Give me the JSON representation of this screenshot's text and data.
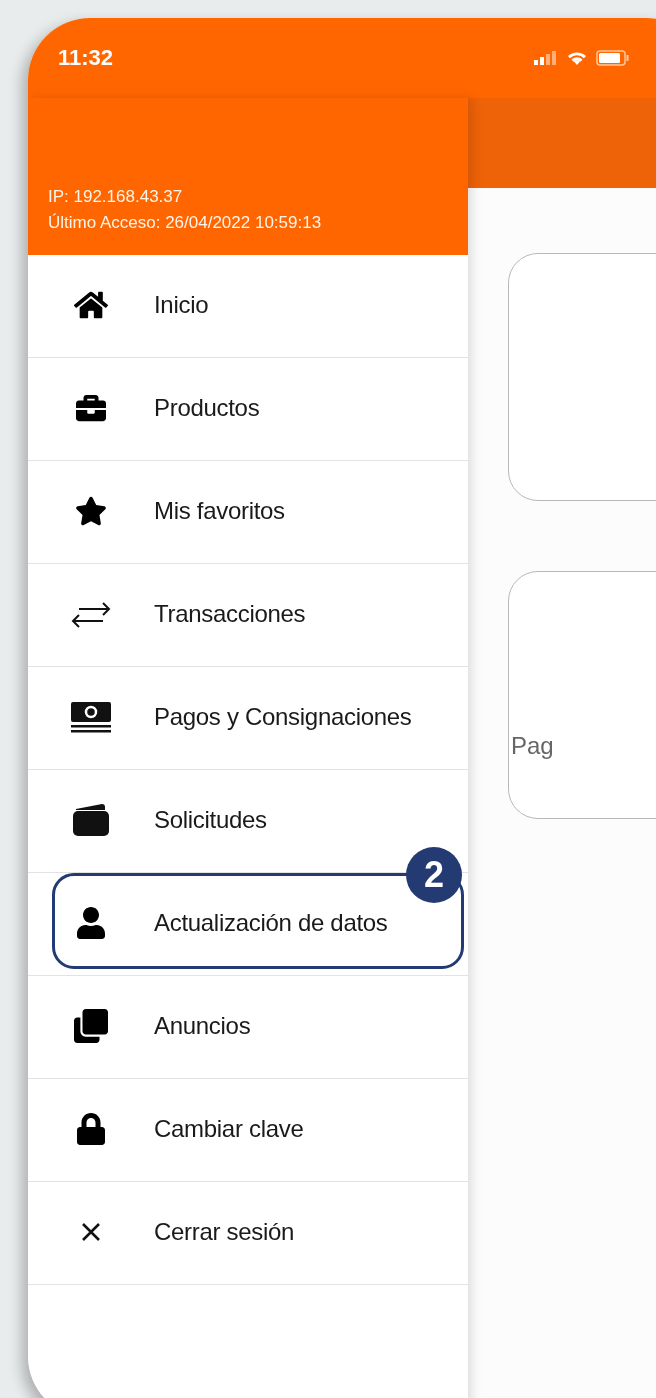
{
  "status_bar": {
    "time": "11:32"
  },
  "drawer": {
    "ip": "IP: 192.168.43.37",
    "last_access": "Último Acceso: 26/04/2022 10:59:13",
    "items": [
      {
        "label": "Inicio",
        "highlighted": false
      },
      {
        "label": "Productos",
        "highlighted": false
      },
      {
        "label": "Mis favoritos",
        "highlighted": false
      },
      {
        "label": "Transacciones",
        "highlighted": false
      },
      {
        "label": "Pagos y Consignaciones",
        "highlighted": false
      },
      {
        "label": "Solicitudes",
        "highlighted": false
      },
      {
        "label": "Actualización de datos",
        "highlighted": true,
        "badge": "2"
      },
      {
        "label": "Anuncios",
        "highlighted": false
      },
      {
        "label": "Cambiar clave",
        "highlighted": false
      },
      {
        "label": "Cerrar sesión",
        "highlighted": false
      }
    ]
  },
  "background_screen": {
    "cards": [
      {
        "kind": "blank"
      },
      {
        "kind": "labeled",
        "label": "Pag"
      }
    ]
  }
}
